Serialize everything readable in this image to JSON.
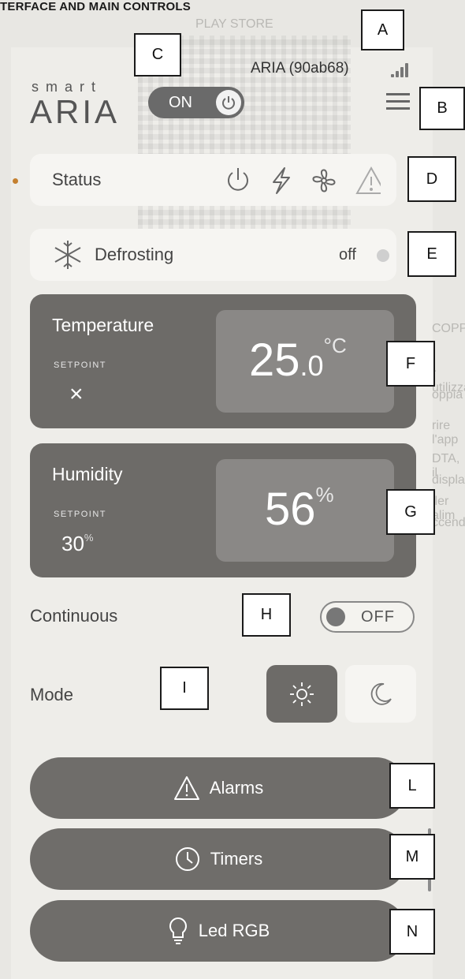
{
  "doc": {
    "header": "TERFACE AND MAIN CONTROLS",
    "background_text": [
      "PLAY STORE",
      "COPPIA",
      "r utilizzare",
      "oppia",
      "rire l'app",
      "DTA, il",
      "display",
      "iler alim",
      "ccende"
    ]
  },
  "topbar": {
    "device_name": "ARIA (90ab68)",
    "signal_icon": "signal-bars-icon",
    "brand_small": "smart",
    "brand_large": "ARIA",
    "power_toggle_label": "ON",
    "menu_icon": "hamburger-menu-icon"
  },
  "status": {
    "label": "Status",
    "icons": [
      "power-icon",
      "lightning-icon",
      "fan-icon",
      "warning-icon"
    ]
  },
  "defrost": {
    "label": "Defrosting",
    "state": "off"
  },
  "temperature": {
    "title": "Temperature",
    "setpoint_label": "SETPOINT",
    "setpoint_value": "×",
    "value_int": "25",
    "value_dec": ".0",
    "unit": "°C"
  },
  "humidity": {
    "title": "Humidity",
    "setpoint_label": "SETPOINT",
    "setpoint_value": "30",
    "setpoint_unit": "%",
    "value": "56",
    "unit": "%"
  },
  "continuous": {
    "label": "Continuous",
    "toggle_label": "OFF"
  },
  "mode": {
    "label": "Mode",
    "options": [
      "sun-icon",
      "moon-icon"
    ],
    "selected": "sun-icon"
  },
  "buttons": {
    "alarms": "Alarms",
    "timers": "Timers",
    "led": "Led RGB"
  },
  "callouts": {
    "A": "A",
    "B": "B",
    "C": "C",
    "D": "D",
    "E": "E",
    "F": "F",
    "G": "G",
    "H": "H",
    "I": "I",
    "L": "L",
    "M": "M",
    "N": "N"
  },
  "colors": {
    "panel": "#6d6b68",
    "panel_inner": "#8a8886",
    "card": "#f6f5f2",
    "status_dot": "#c48030"
  }
}
